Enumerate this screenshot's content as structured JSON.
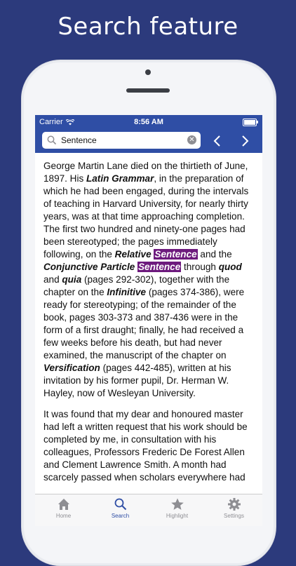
{
  "promo": {
    "title": "Search feature"
  },
  "status": {
    "carrier": "Carrier",
    "time": "8:56 AM",
    "battery_level": 1.0
  },
  "search": {
    "value": "Sentence"
  },
  "nav": {
    "prev_icon": "chevron-left-icon",
    "next_icon": "chevron-right-icon"
  },
  "content": {
    "p1": [
      {
        "t": "George Martin Lane died on the thirtieth of June, 1897. His "
      },
      {
        "t": "Latin Grammar",
        "s": "b"
      },
      {
        "t": ", in the preparation of which he had been engaged, during the intervals of teaching in Harvard University, for nearly thirty years, was at that time approaching completion. The first two hundred and ninety-one pages had been stereotyped; the pages immediately following, on the "
      },
      {
        "t": "Relative",
        "s": "b"
      },
      {
        "t": " "
      },
      {
        "t": "Sentence",
        "s": "m"
      },
      {
        "t": " and the "
      },
      {
        "t": "Conjunctive Particle",
        "s": "b"
      },
      {
        "t": " "
      },
      {
        "t": "Sentence",
        "s": "m"
      },
      {
        "t": " through "
      },
      {
        "t": "quod",
        "s": "b"
      },
      {
        "t": " and "
      },
      {
        "t": "quia",
        "s": "b"
      },
      {
        "t": " (pages 292-302), together with the chapter on the "
      },
      {
        "t": "Infinitive",
        "s": "b"
      },
      {
        "t": " (pages 374-386), were ready for stereotyping; of the remainder of the book, pages 303-373 and 387-436 were in the form of a first draught; finally, he had received a few weeks before his death, but had never examined, the manuscript of the chapter on "
      },
      {
        "t": "Versification",
        "s": "b"
      },
      {
        "t": " (pages 442-485), written at his invitation by his former pupil, Dr. Herman W. Hayley, now of Wesleyan University."
      }
    ],
    "p2": "It was found that my dear and honoured master had left a written request that his work should be completed by me, in consultation with his colleagues, Professors Frederic De Forest Allen and Clement Lawrence Smith. A month had scarcely passed when scholars everywhere had"
  },
  "tabs": [
    {
      "label": "Home",
      "icon": "home-icon",
      "active": false
    },
    {
      "label": "Search",
      "icon": "search-icon",
      "active": true
    },
    {
      "label": "Highlight",
      "icon": "star-icon",
      "active": false
    },
    {
      "label": "Settings",
      "icon": "gear-icon",
      "active": false
    }
  ],
  "colors": {
    "background": "#2c3a7c",
    "accent": "#2f4ea5",
    "highlight": "#6d1a7d"
  }
}
